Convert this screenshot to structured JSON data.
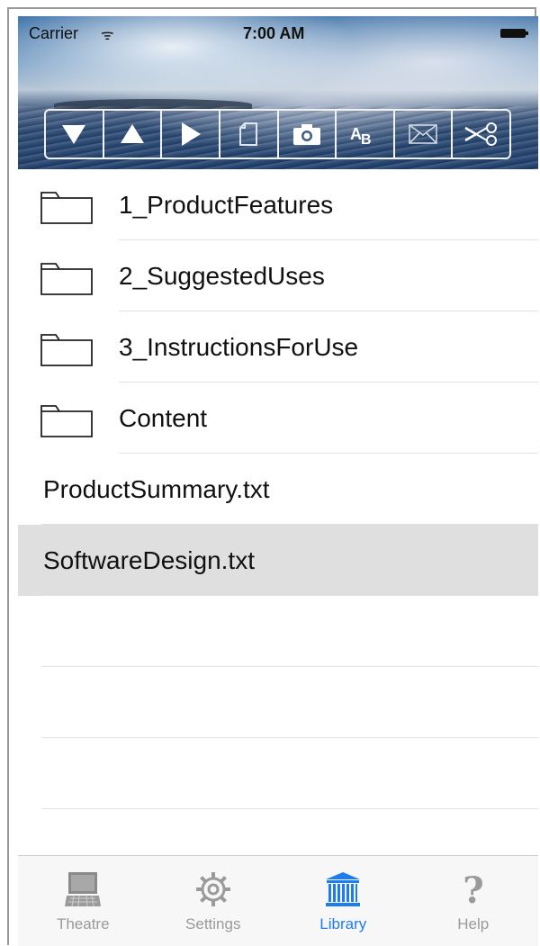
{
  "status_bar": {
    "carrier": "Carrier",
    "wifi": "ᯤ",
    "time": "7:00 AM"
  },
  "toolbar": {
    "buttons": [
      {
        "icon": "triangle-down-icon"
      },
      {
        "icon": "triangle-up-icon"
      },
      {
        "icon": "play-icon"
      },
      {
        "icon": "document-icon"
      },
      {
        "icon": "camera-icon"
      },
      {
        "icon": "font-size-icon"
      },
      {
        "icon": "mail-icon"
      },
      {
        "icon": "scissors-icon"
      }
    ]
  },
  "list": {
    "folders": [
      {
        "label": "1_ProductFeatures"
      },
      {
        "label": "2_SuggestedUses"
      },
      {
        "label": "3_InstructionsForUse"
      },
      {
        "label": "Content"
      }
    ],
    "files": [
      {
        "label": "ProductSummary.txt",
        "selected": false
      },
      {
        "label": "SoftwareDesign.txt",
        "selected": true
      }
    ]
  },
  "tabbar": {
    "tabs": [
      {
        "label": "Theatre",
        "icon": "theatre-icon",
        "active": false
      },
      {
        "label": "Settings",
        "icon": "gear-icon",
        "active": false
      },
      {
        "label": "Library",
        "icon": "library-icon",
        "active": true
      },
      {
        "label": "Help",
        "icon": "question-icon",
        "active": false
      }
    ],
    "active_color": "#1e7cf0",
    "inactive_color": "#9a9a9a"
  }
}
